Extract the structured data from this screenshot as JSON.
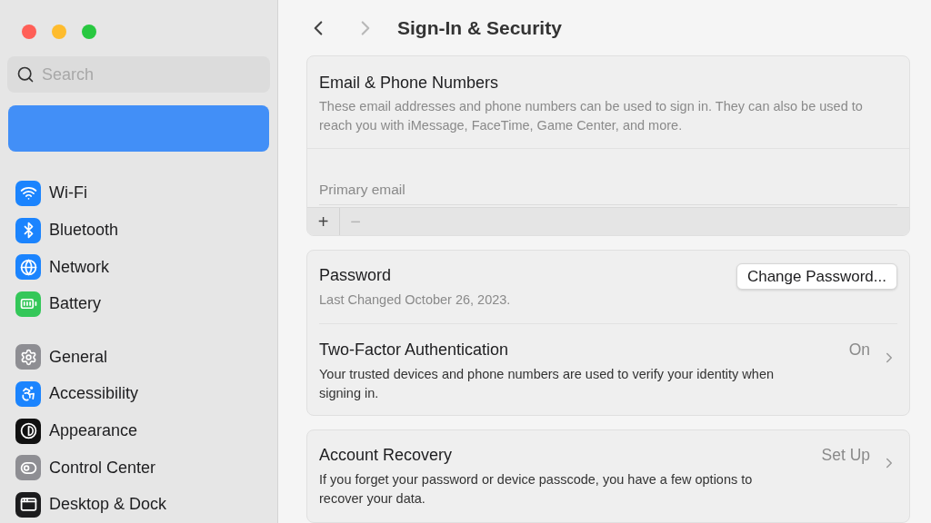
{
  "toolbar": {
    "title": "Sign-In & Security",
    "back": {
      "disabled": false
    },
    "forward": {
      "disabled": true
    }
  },
  "sidebar": {
    "search": {
      "placeholder": "Search"
    },
    "account": {
      "selected": true
    },
    "groups": [
      [
        {
          "label": "Wi-Fi",
          "selected": false,
          "color": "#1b84fe"
        },
        {
          "label": "Bluetooth",
          "selected": false,
          "color": "#1b84fe"
        },
        {
          "label": "Network",
          "selected": false,
          "color": "#1b84fe"
        },
        {
          "label": "Battery",
          "selected": false,
          "color": "#34c759"
        }
      ],
      [
        {
          "label": "General",
          "selected": false,
          "color": "#8e8e93"
        },
        {
          "label": "Accessibility",
          "selected": false,
          "color": "#1b84fe"
        },
        {
          "label": "Appearance",
          "selected": false,
          "color": "#111111"
        },
        {
          "label": "Control Center",
          "selected": false,
          "color": "#8e8e93"
        },
        {
          "label": "Desktop & Dock",
          "selected": false,
          "color": "#1c1c1e"
        }
      ]
    ]
  },
  "email_section": {
    "title": "Email & Phone Numbers",
    "description": "These email addresses and phone numbers can be used to sign in. They can also be used to reach you with iMessage, FaceTime, Game Center, and more.",
    "fields": [
      {
        "placeholder": "Primary email"
      }
    ],
    "actions": [
      {
        "label": "+",
        "disabled": false
      },
      {
        "label": "−",
        "disabled": true
      }
    ]
  },
  "sections": [
    {
      "rows": [
        {
          "kind": "button",
          "title": "Password",
          "subtitle": "Last Changed October 26, 2023.",
          "button": "Change Password..."
        },
        {
          "kind": "link",
          "title": "Two-Factor Authentication",
          "subtitle": "Your trusted devices and phone numbers are used to verify your identity when signing in.",
          "value": "On"
        }
      ]
    },
    {
      "rows": [
        {
          "kind": "link",
          "title": "Account Recovery",
          "subtitle": "If you forget your password or device passcode, you have a few options to recover your data.",
          "value": "Set Up"
        }
      ]
    }
  ]
}
